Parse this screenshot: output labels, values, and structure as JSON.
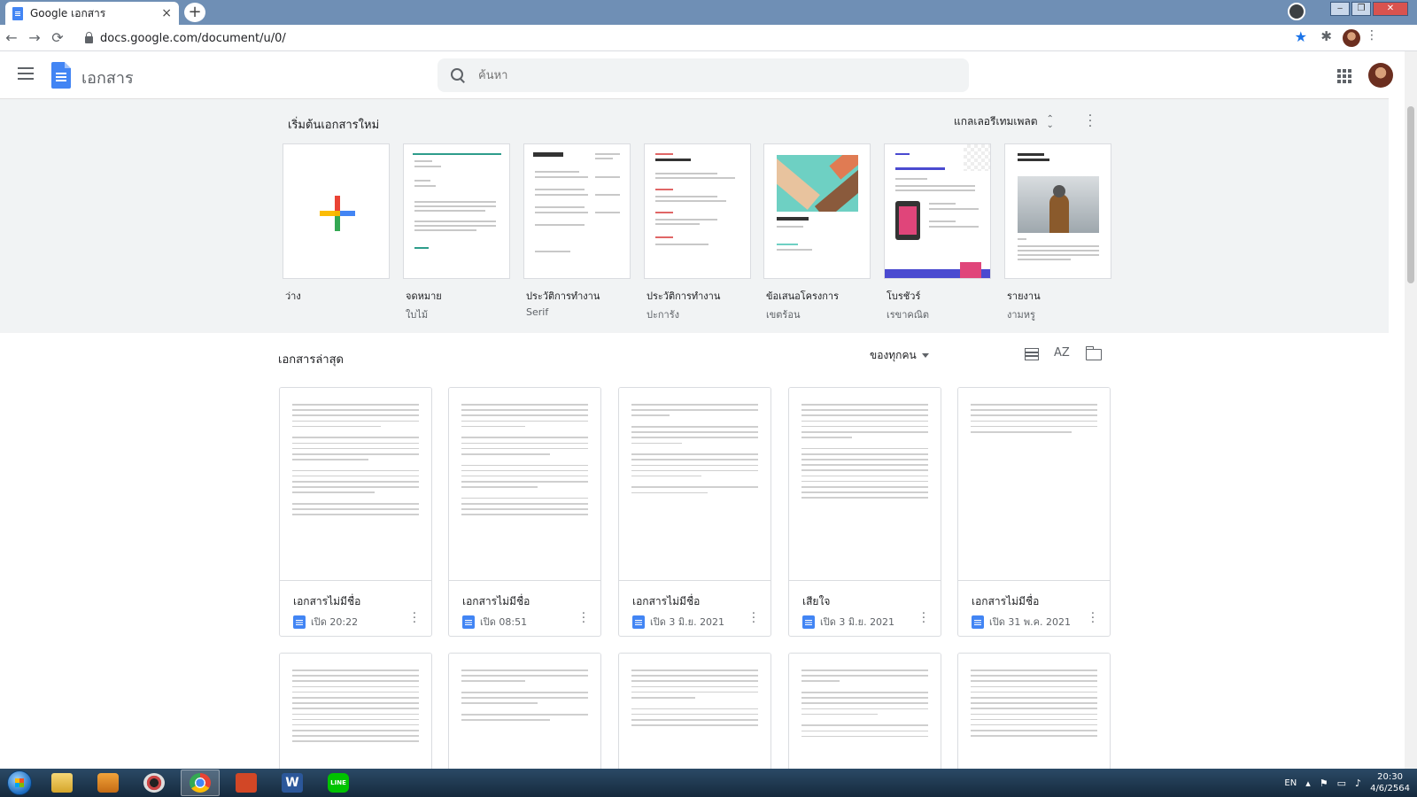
{
  "browser": {
    "tab_title": "Google เอกสาร",
    "tab_close": "×",
    "new_tab": "+",
    "url": "docs.google.com/document/u/0/",
    "back": "←",
    "forward": "→",
    "reload": "⟳",
    "star": "★",
    "extensions": "✱",
    "menu": "⋮",
    "win_minimize": "‒",
    "win_maximize": "❐",
    "win_close": "✕"
  },
  "header": {
    "app_title": "เอกสาร",
    "search_placeholder": "ค้นหา"
  },
  "templates": {
    "heading": "เริ่มต้นเอกสารใหม่",
    "gallery_label": "แกลเลอรีเทมเพลต",
    "items": [
      {
        "name": "ว่าง",
        "sub": ""
      },
      {
        "name": "จดหมาย",
        "sub": "ใบไม้"
      },
      {
        "name": "ประวัติการทำงาน",
        "sub": "Serif"
      },
      {
        "name": "ประวัติการทำงาน",
        "sub": "ปะการัง"
      },
      {
        "name": "ข้อเสนอโครงการ",
        "sub": "เขตร้อน"
      },
      {
        "name": "โบรชัวร์",
        "sub": "เรขาคณิต"
      },
      {
        "name": "รายงาน",
        "sub": "งามหรู"
      }
    ]
  },
  "recent": {
    "heading": "เอกสารล่าสุด",
    "owner_filter": "ของทุกคน",
    "sort_label": "AZ",
    "docs": [
      {
        "title": "เอกสารไม่มีชื่อ",
        "opened": "เปิด 20:22"
      },
      {
        "title": "เอกสารไม่มีชื่อ",
        "opened": "เปิด 08:51"
      },
      {
        "title": "เอกสารไม่มีชื่อ",
        "opened": "เปิด 3 มิ.ย. 2021"
      },
      {
        "title": "เสียใจ",
        "opened": "เปิด 3 มิ.ย. 2021"
      },
      {
        "title": "เอกสารไม่มีชื่อ",
        "opened": "เปิด 31 พ.ค. 2021"
      }
    ]
  },
  "taskbar": {
    "word_letter": "W",
    "line_label": "LINE",
    "lang": "EN",
    "time": "20:30",
    "date": "4/6/2564"
  },
  "colors": {
    "docs_blue": "#4285f4",
    "template_bg": "#f1f3f4",
    "accent_star": "#1a73e8"
  }
}
